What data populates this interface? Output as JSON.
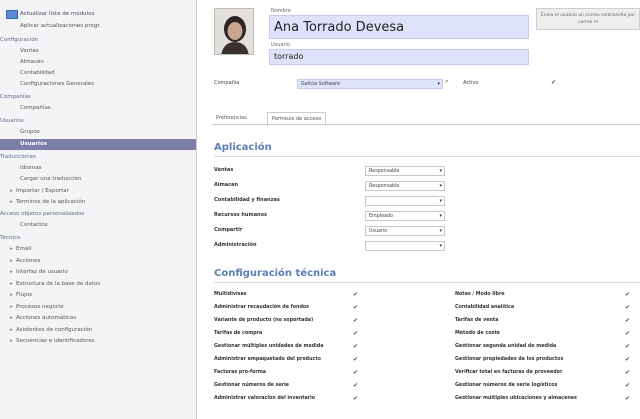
{
  "sidebar": {
    "rows": [
      {
        "label": "Actualizar lista de módulos",
        "kind": "top",
        "top": true
      },
      {
        "label": "Aplicar actualizaciones progr.",
        "kind": "item"
      },
      {
        "label": "Configuración",
        "kind": "head"
      },
      {
        "label": "Ventas",
        "kind": "item"
      },
      {
        "label": "Almacén",
        "kind": "item"
      },
      {
        "label": "Contabilidad",
        "kind": "item"
      },
      {
        "label": "Configuraciones Generales",
        "kind": "item"
      },
      {
        "label": "Compañías",
        "kind": "head"
      },
      {
        "label": "Compañías",
        "kind": "item"
      },
      {
        "label": "Usuarios",
        "kind": "head"
      },
      {
        "label": "Grupos",
        "kind": "item"
      },
      {
        "label": "Usuarios",
        "kind": "item",
        "active": true
      },
      {
        "label": "Traducciones",
        "kind": "head"
      },
      {
        "label": "Idiomas",
        "kind": "item"
      },
      {
        "label": "Cargar una traducción",
        "kind": "item"
      },
      {
        "label": "Importar / Exportar",
        "kind": "sub"
      },
      {
        "label": "Términos de la aplicación",
        "kind": "sub"
      },
      {
        "label": "Acceso objetos personalizados",
        "kind": "head"
      },
      {
        "label": "Contactos",
        "kind": "item"
      },
      {
        "label": "Técnico",
        "kind": "head"
      },
      {
        "label": "Email",
        "kind": "sub"
      },
      {
        "label": "Acciones",
        "kind": "sub"
      },
      {
        "label": "Interfaz de usuario",
        "kind": "sub"
      },
      {
        "label": "Estructura de la base de datos",
        "kind": "sub"
      },
      {
        "label": "Flujos",
        "kind": "sub"
      },
      {
        "label": "Procesos negocio",
        "kind": "sub"
      },
      {
        "label": "Acciones automáticas",
        "kind": "sub"
      },
      {
        "label": "Asistentes de configuración",
        "kind": "sub"
      },
      {
        "label": "Secuencias e identificadores",
        "kind": "sub"
      }
    ]
  },
  "form": {
    "name_label": "Nombre",
    "name_value": "Ana Torrado Devesa",
    "login_label": "Usuario",
    "login_value": "torrado",
    "hint": "Envía el usuario un correo contraseña por correo el",
    "company_label": "Compañía",
    "company_value": "Galicia Software",
    "active_label": "Activo",
    "active_check": "✔"
  },
  "tabs": [
    {
      "label": "Preferencias",
      "active": false
    },
    {
      "label": "Permisos de acceso",
      "active": true
    }
  ],
  "application": {
    "title": "Aplicación",
    "rows": [
      {
        "label": "Ventas",
        "value": "Responsable"
      },
      {
        "label": "Almacén",
        "value": "Responsable"
      },
      {
        "label": "Contabilidad y finanzas",
        "value": ""
      },
      {
        "label": "Recursos humanos",
        "value": "Empleado"
      },
      {
        "label": "Compartir",
        "value": "Usuario"
      },
      {
        "label": "Administración",
        "value": ""
      }
    ]
  },
  "technical": {
    "title": "Configuración técnica",
    "check": "✔",
    "left": [
      "Multidivisas",
      "Administrar recaudación de fondos",
      "Variante de producto (no soportada)",
      "Tarifas de compra",
      "Gestionar múltiples unidades de medida",
      "Administrar empaquetado del producto",
      "Facturas pro-forma",
      "Gestionar números de serie",
      "Administrar valoración del inventario"
    ],
    "right": [
      "Notas / Modo libre",
      "Contabilidad analítica",
      "Tarifas de venta",
      "Método de coste",
      "Gestionar segunda unidad de medida",
      "Gestionar propiedades de los productos",
      "Verificar total en facturas de proveedor",
      "Gestionar números de serie logísticos",
      "Gestionar múltiples ubicaciones y almacenes"
    ]
  },
  "icons": {
    "external": "↗",
    "dropdown": "▾"
  }
}
